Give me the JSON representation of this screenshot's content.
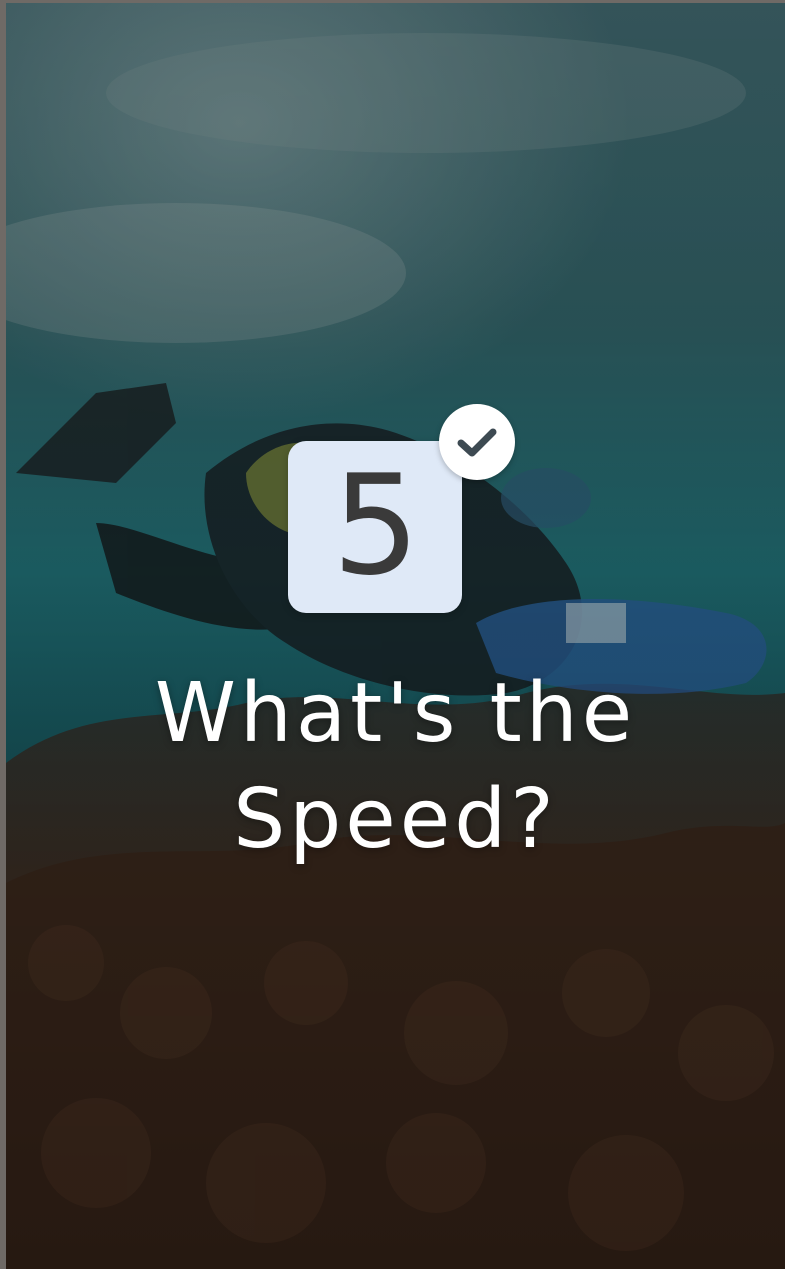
{
  "slide": {
    "step_number": "5",
    "title_line1": "What's the",
    "title_line2": "Speed?",
    "completed_icon": "check-icon",
    "badge_color": "#dfe9f7",
    "text_color": "#ffffff"
  }
}
